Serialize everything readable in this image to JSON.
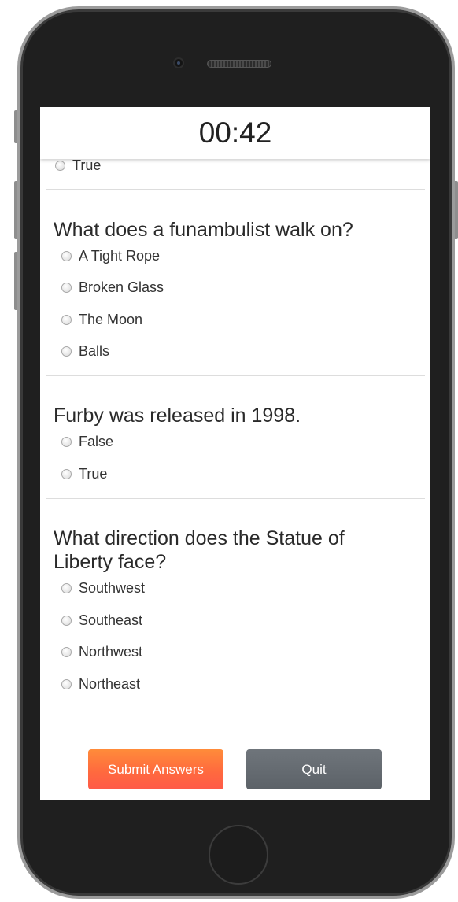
{
  "timer": {
    "value": "00:42"
  },
  "previous_question": {
    "options": [
      "True"
    ]
  },
  "questions": [
    {
      "text": "What does a funambulist walk on?",
      "options": [
        "A Tight Rope",
        "Broken Glass",
        "The Moon",
        "Balls"
      ]
    },
    {
      "text": "Furby was released in 1998.",
      "options": [
        "False",
        "True"
      ]
    },
    {
      "text": "What direction does the Statue of Liberty face?",
      "options": [
        "Southwest",
        "Southeast",
        "Northwest",
        "Northeast"
      ]
    }
  ],
  "actions": {
    "submit_label": "Submit Answers",
    "quit_label": "Quit"
  },
  "colors": {
    "submit_gradient_top": "#ff8c3a",
    "submit_gradient_bottom": "#ff5a48",
    "quit_background": "#5c6268",
    "divider": "#dddddd"
  }
}
